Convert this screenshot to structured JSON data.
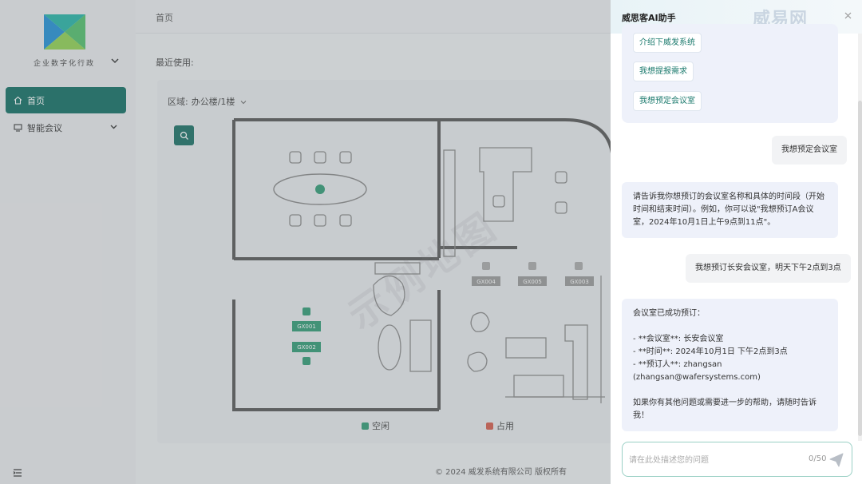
{
  "colors": {
    "accent": "#0f6d61",
    "available": "#2e9a74",
    "occupied": "#d45a4a",
    "panel_bubble": "#eef1fa"
  },
  "sidebar": {
    "org_name": "企业数字化行政",
    "org_icon": "chevron-down-icon",
    "items": [
      {
        "label": "首页",
        "icon": "home-icon",
        "active": true
      },
      {
        "label": "智能会议",
        "icon": "meeting-icon",
        "active": false,
        "has_children": true
      }
    ],
    "collapse_icon": "menu-collapse-icon"
  },
  "header": {
    "breadcrumb": "首页"
  },
  "main": {
    "recent_label": "最近使用:",
    "area_label": "区域:",
    "area_value": "办公楼/1楼",
    "room_tags": [
      "GX001",
      "GX002",
      "GX003",
      "GX004",
      "GX005"
    ],
    "legend": [
      {
        "label": "空闲",
        "color": "#2e9a74"
      },
      {
        "label": "占用",
        "color": "#d45a4a"
      }
    ],
    "footer": "© 2024 威发系统有限公司 版权所有",
    "watermark": "示例地图"
  },
  "ai_panel": {
    "title": "威思客AI助手",
    "brand_watermark": "威易网",
    "suggestions": [
      "介绍下威发系统",
      "我想提报需求",
      "我想预定会议室"
    ],
    "messages": [
      {
        "role": "user",
        "text": "我想预定会议室"
      },
      {
        "role": "assistant",
        "lines": [
          "请告诉我你想预订的会议室名称和具体的时间段（开始",
          "时间和结束时间）。例如，你可以说\"我想预订A会议",
          "室，2024年10月1日上午9点到11点\"。"
        ]
      },
      {
        "role": "user",
        "text": "我想预订长安会议室，明天下午2点到3点"
      },
      {
        "role": "assistant",
        "lines": [
          "会议室已成功预订：",
          "",
          "- **会议室**: 长安会议室",
          "- **时间**: 2024年10月1日 下午2点到3点",
          "- **预订人**: zhangsan (zhangsan@wafersystems.com)",
          "",
          "如果你有其他问题或需要进一步的帮助，请随时告诉",
          "我！"
        ]
      }
    ],
    "input": {
      "placeholder": "请在此处描述您的问题",
      "value": "",
      "counter": "0/50"
    }
  }
}
